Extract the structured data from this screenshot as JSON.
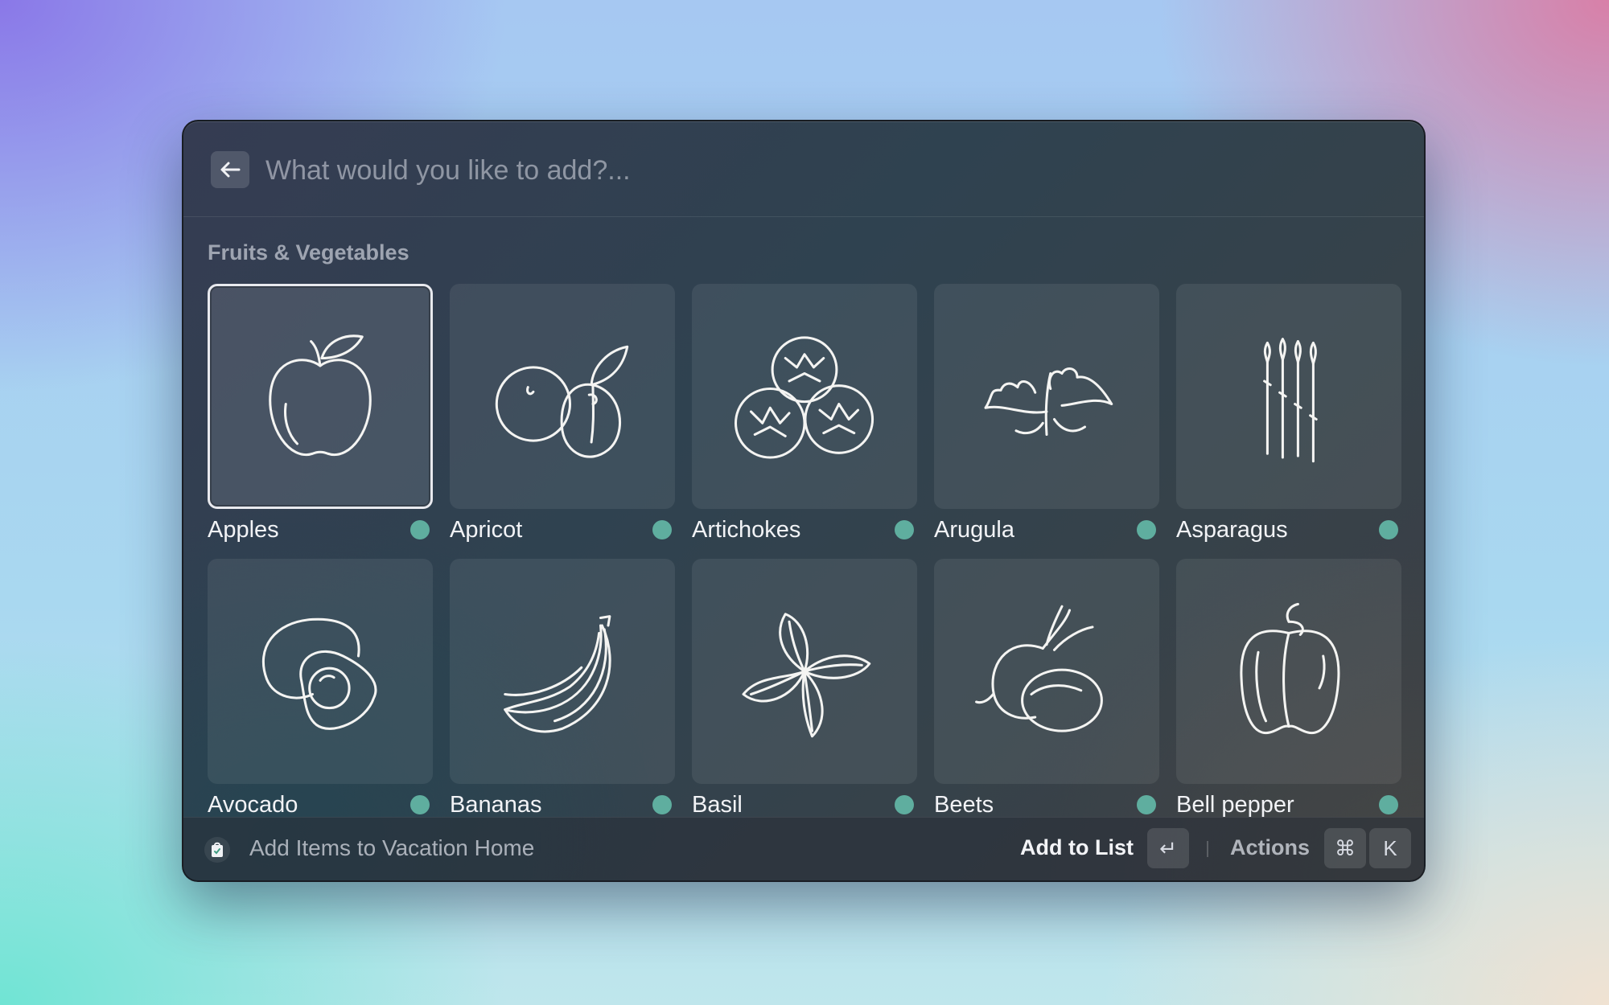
{
  "search": {
    "placeholder": "What would you like to add?...",
    "back_icon": "arrow-left-icon"
  },
  "section": {
    "title": "Fruits & Vegetables"
  },
  "items": [
    {
      "label": "Apples",
      "icon": "apple-icon",
      "status_color": "#5fae9f",
      "selected": true
    },
    {
      "label": "Apricot",
      "icon": "apricot-icon",
      "status_color": "#5fae9f",
      "selected": false
    },
    {
      "label": "Artichokes",
      "icon": "artichoke-icon",
      "status_color": "#5fae9f",
      "selected": false
    },
    {
      "label": "Arugula",
      "icon": "arugula-icon",
      "status_color": "#5fae9f",
      "selected": false
    },
    {
      "label": "Asparagus",
      "icon": "asparagus-icon",
      "status_color": "#5fae9f",
      "selected": false
    },
    {
      "label": "Avocado",
      "icon": "avocado-icon",
      "status_color": "#5fae9f",
      "selected": false
    },
    {
      "label": "Bananas",
      "icon": "banana-icon",
      "status_color": "#5fae9f",
      "selected": false
    },
    {
      "label": "Basil",
      "icon": "basil-icon",
      "status_color": "#5fae9f",
      "selected": false
    },
    {
      "label": "Beets",
      "icon": "beet-icon",
      "status_color": "#5fae9f",
      "selected": false
    },
    {
      "label": "Bell pepper",
      "icon": "bell-pepper-icon",
      "status_color": "#5fae9f",
      "selected": false
    }
  ],
  "footer": {
    "title": "Add Items to Vacation Home",
    "list_icon": "shopping-bag-icon",
    "primary_action": "Add to List",
    "primary_shortcut": "↵",
    "actions_label": "Actions",
    "actions_shortcut_mod": "⌘",
    "actions_shortcut_key": "K"
  },
  "colors": {
    "accent_dot": "#5fae9f",
    "selection_border": "#e8e9ee"
  }
}
